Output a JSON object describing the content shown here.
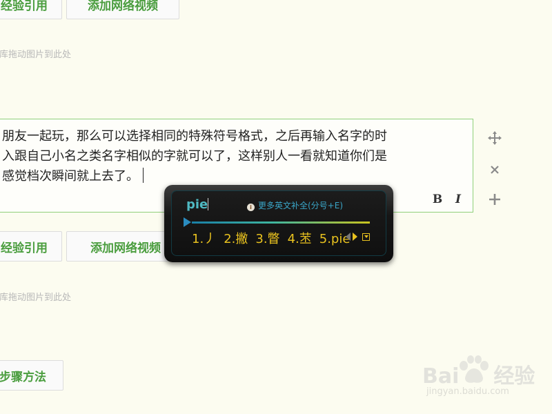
{
  "top_row": {
    "quote_button": "经验引用",
    "video_button": "添加网络视频"
  },
  "drop_hint": "图库拖动图片到此处",
  "editor": {
    "lines": [
      "朋友一起玩，那么可以选择相同的特殊符号格式，之后再输入名字的时",
      "入跟自己小名之类名字相似的字就可以了，这样别人一看就知道你们是",
      "感觉档次瞬间就上去了。"
    ],
    "bold_label": "B",
    "italic_label": "I"
  },
  "side_tools": {
    "move_icon": "move-icon",
    "delete_icon": "close-icon",
    "add_icon": "plus-icon"
  },
  "ime": {
    "composition": "pie",
    "more_hint": "更多英文补全(分号+E)",
    "candidates": [
      "1.丿",
      "2.撇",
      "3.瞥",
      "4.苤",
      "5.pie"
    ],
    "accent": "#e9c21f",
    "comp_color": "#4fb9c2"
  },
  "middle_row": {
    "quote_button": "经验引用",
    "video_button": "添加网络视频"
  },
  "drop_hint_2": "图库拖动图片到此处",
  "steps_button": "步骤方法",
  "watermark": {
    "brand": "Bai",
    "brand_suffix": "经验",
    "url": "jingyan.baidu.com"
  }
}
